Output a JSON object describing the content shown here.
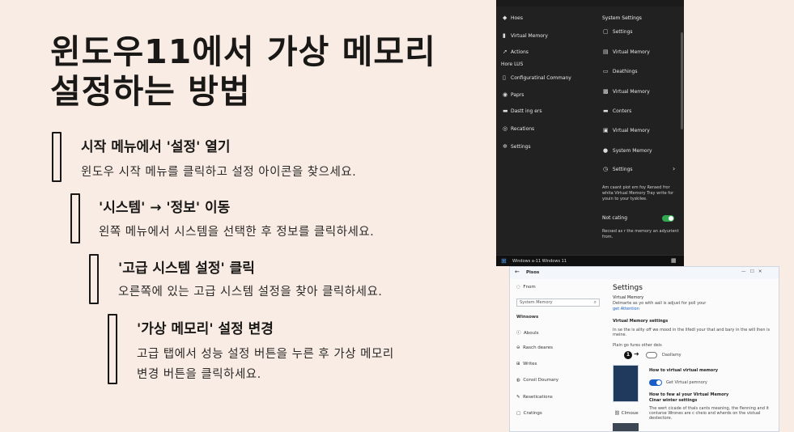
{
  "slide": {
    "title_line1": "윈도우11에서 가상 메모리",
    "title_line2": "설정하는 방법",
    "steps": [
      {
        "title": "시작 메뉴에서 '설정' 열기",
        "desc1": "윈도우 시작 메뉴를 클릭하고 설정 아이콘을 찾으세요.",
        "desc2": ""
      },
      {
        "title": "'시스템' → '정보' 이동",
        "desc1": "왼쪽 메뉴에서 시스템을 선택한 후 정보를 클릭하세요.",
        "desc2": ""
      },
      {
        "title": "'고급 시스템 설정' 클릭",
        "desc1": "오른쪽에 있는 고급 시스템 설정을 찾아 클릭하세요.",
        "desc2": ""
      },
      {
        "title": "'가상 메모리' 설정 변경",
        "desc1": "고급 탭에서 성능 설정 버튼을 누른 후 가상 메모리",
        "desc2": "변경 버튼을 클릭하세요."
      }
    ]
  },
  "dark_screenshot": {
    "left_menu": [
      {
        "icon": "home-icon",
        "glyph": "◆",
        "label": "Hoes"
      },
      {
        "icon": "memory-icon",
        "glyph": "▮",
        "label": "Virtual Memory"
      },
      {
        "icon": "pin-icon",
        "glyph": "➚",
        "label": "Actions"
      },
      {
        "icon": "",
        "glyph": "",
        "label": "Hore LUS"
      },
      {
        "icon": "config-icon",
        "glyph": "▯",
        "label": "Configuratinal Commany"
      },
      {
        "icon": "info-icon",
        "glyph": "◉",
        "label": "Paprs"
      },
      {
        "icon": "device-icon",
        "glyph": "▬",
        "label": "Dastt ing ers"
      },
      {
        "icon": "location-icon",
        "glyph": "◎",
        "label": "Recations"
      },
      {
        "icon": "settings-icon",
        "glyph": "✲",
        "label": "Settings"
      }
    ],
    "right_header": "System Settings",
    "right_menu": [
      {
        "icon": "settings-icon",
        "glyph": "▢",
        "label": "Settings"
      },
      {
        "icon": "memory-icon",
        "glyph": "▤",
        "label": "Virtual Memory"
      },
      {
        "icon": "monitor-icon",
        "glyph": "▭",
        "label": "Deathings"
      },
      {
        "icon": "chip-icon",
        "glyph": "▩",
        "label": "Virtual Memory"
      },
      {
        "icon": "folder-icon",
        "glyph": "▬",
        "label": "Conters"
      },
      {
        "icon": "shield-icon",
        "glyph": "▣",
        "label": "Virtual Memory"
      },
      {
        "icon": "info-icon",
        "glyph": "●",
        "label": "System Memory"
      },
      {
        "icon": "clock-icon",
        "glyph": "◷",
        "label": "Settings"
      }
    ],
    "settings_chevron": "›",
    "note1": "Am caant piot em foy Reraed fror whita Virtual Memory Tray write for youin to your tyskilee.",
    "toggle_label": "Not cating",
    "note2": "Recsed as r the memory an adyurient from.",
    "taskbar_text": "Windows a-11 Windows 11",
    "taskbar_right": "▦"
  },
  "light_screenshot": {
    "window_title": "Pisos",
    "window_controls": "—   ☐   ✕",
    "left_link": "Fnom",
    "search_placeholder": "System Memory",
    "section_label": "Winsows",
    "left_menu": [
      {
        "icon": "info-icon",
        "glyph": "ⓘ",
        "label": "Abouls"
      },
      {
        "icon": "network-icon",
        "glyph": "⊖",
        "label": "Rasch deares"
      },
      {
        "icon": "grid-icon",
        "glyph": "⊞",
        "label": "Writes"
      },
      {
        "icon": "globe-icon",
        "glyph": "◍",
        "label": "Consil Doumary"
      },
      {
        "icon": "pen-icon",
        "glyph": "✎",
        "label": "Resetications"
      },
      {
        "icon": "box-icon",
        "glyph": "▢",
        "label": "Cratings"
      }
    ],
    "main_title": "Settings",
    "vm_heading": "Virtual Memory",
    "vm_line": "Delmarte as yo with aall is adjust for poll your",
    "vm_link": "get Attention",
    "vms_heading": "Virtual Memory settings",
    "vms_desc1": "In se the is ality off we mood in the lifedl your that and bary in the will lhen is",
    "vms_desc2": "meine.",
    "plain_text": "Plain go fures other deis",
    "step_number": "1",
    "pill_label": "Daollamy",
    "how_heading": "How to virtual virtual memory",
    "toggle_label": "Get Virtual pemnory",
    "how2_heading": "How to few al your Virtual Memory",
    "how2_sub": "Cinar winter settings",
    "how2_desc1": "The wert cicade of thals cants meaning, the flenning and it",
    "how2_desc2": "contarse Wrones are c cheio and wherds on the vistual",
    "how2_desc3": "destectore.",
    "side_label": "Clmoue"
  }
}
